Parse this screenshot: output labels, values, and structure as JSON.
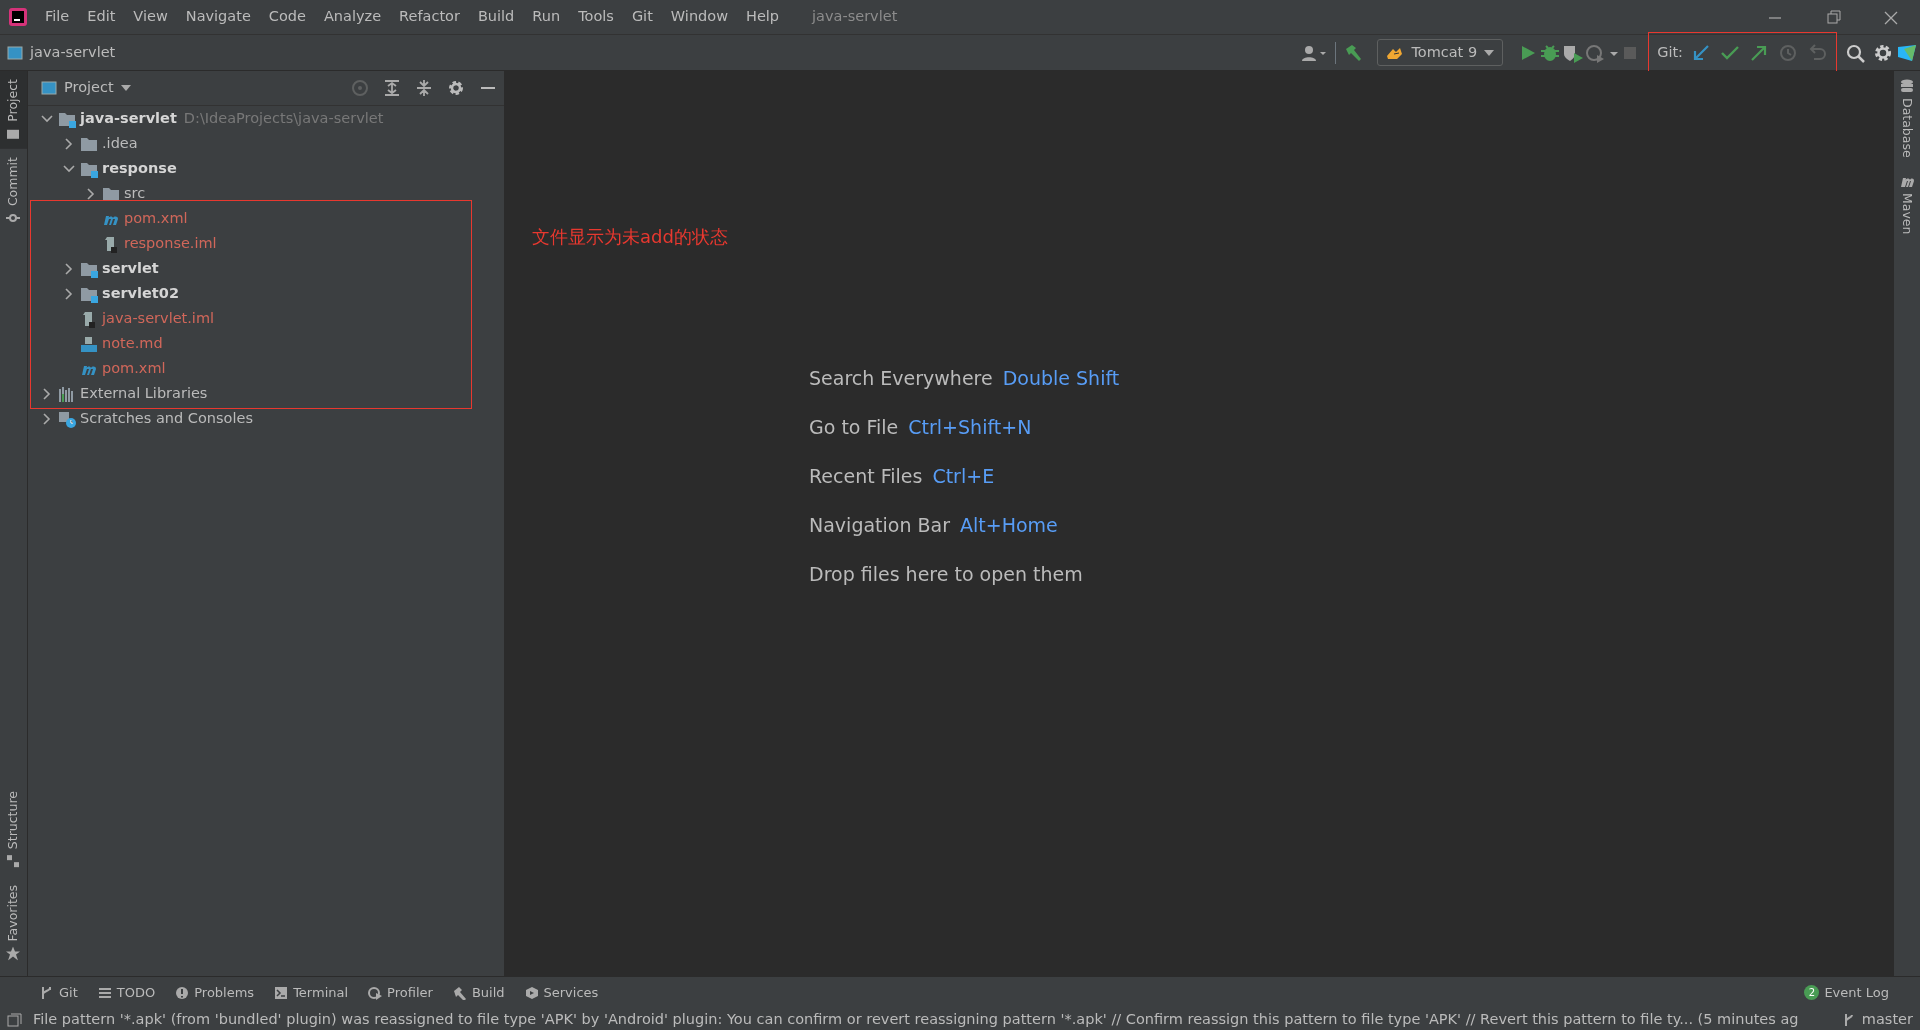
{
  "window": {
    "title": "java-servlet",
    "menu": [
      {
        "label": "File"
      },
      {
        "label": "Edit"
      },
      {
        "label": "View"
      },
      {
        "label": "Navigate"
      },
      {
        "label": "Code"
      },
      {
        "label": "Analyze"
      },
      {
        "label": "Refactor"
      },
      {
        "label": "Build"
      },
      {
        "label": "Run"
      },
      {
        "label": "Tools"
      },
      {
        "label": "Git"
      },
      {
        "label": "Window"
      },
      {
        "label": "Help"
      }
    ]
  },
  "navigation_bar": {
    "breadcrumb": "java-servlet"
  },
  "toolbar": {
    "run_configuration": "Tomcat 9",
    "git_label": "Git:"
  },
  "left_strip": {
    "top": [
      {
        "label": "Project",
        "selected": true
      },
      {
        "label": "Commit",
        "selected": false
      }
    ],
    "bottom": [
      {
        "label": "Structure",
        "selected": false
      },
      {
        "label": "Favorites",
        "selected": false
      }
    ]
  },
  "right_strip": [
    {
      "label": "Database"
    },
    {
      "label": "Maven"
    }
  ],
  "project_panel": {
    "title": "Project",
    "tree": [
      {
        "name": "java-servlet",
        "path": "D:\\IdeaProjects\\java-servlet",
        "kind": "module",
        "bold": true,
        "untracked": false,
        "expanded": true,
        "children": [
          {
            "name": ".idea",
            "kind": "folder",
            "bold": false,
            "untracked": false,
            "expanded": false
          },
          {
            "name": "response",
            "kind": "module",
            "bold": true,
            "untracked": false,
            "expanded": true,
            "children": [
              {
                "name": "src",
                "kind": "folder",
                "bold": false,
                "untracked": false,
                "expanded": false
              },
              {
                "name": "pom.xml",
                "kind": "maven",
                "bold": false,
                "untracked": true
              },
              {
                "name": "response.iml",
                "kind": "iml",
                "bold": false,
                "untracked": true
              }
            ]
          },
          {
            "name": "servlet",
            "kind": "module",
            "bold": true,
            "untracked": false,
            "expanded": false
          },
          {
            "name": "servlet02",
            "kind": "module",
            "bold": true,
            "untracked": false,
            "expanded": false
          },
          {
            "name": "java-servlet.iml",
            "kind": "iml",
            "bold": false,
            "untracked": true
          },
          {
            "name": "note.md",
            "kind": "md",
            "bold": false,
            "untracked": true
          },
          {
            "name": "pom.xml",
            "kind": "maven",
            "bold": false,
            "untracked": true
          }
        ]
      },
      {
        "name": "External Libraries",
        "kind": "libraries",
        "bold": false,
        "untracked": false,
        "expanded": false
      },
      {
        "name": "Scratches and Consoles",
        "kind": "scratches",
        "bold": false,
        "untracked": false,
        "expanded": false
      }
    ]
  },
  "annotation": "文件显示为未add的状态",
  "editor_hints": [
    {
      "label": "Search Everywhere",
      "shortcut": "Double Shift"
    },
    {
      "label": "Go to File",
      "shortcut": "Ctrl+Shift+N"
    },
    {
      "label": "Recent Files",
      "shortcut": "Ctrl+E"
    },
    {
      "label": "Navigation Bar",
      "shortcut": "Alt+Home"
    },
    {
      "label": "Drop files here to open them"
    }
  ],
  "tool_windows": [
    {
      "label": "Git",
      "kind": "git"
    },
    {
      "label": "TODO",
      "kind": "todo"
    },
    {
      "label": "Problems",
      "kind": "problems"
    },
    {
      "label": "Terminal",
      "kind": "terminal"
    },
    {
      "label": "Profiler",
      "kind": "profiler"
    },
    {
      "label": "Build",
      "kind": "build"
    },
    {
      "label": "Services",
      "kind": "services"
    }
  ],
  "event_log": {
    "count": "2",
    "label": "Event Log"
  },
  "status_bar": {
    "message": "File pattern '*.apk' (from 'bundled' plugin) was reassigned to file type 'APK' by 'Android' plugin: You can confirm or revert reassigning pattern '*.apk' // Confirm reassign this pattern to file type 'APK' // Revert this pattern to file ty... (5 minutes ag",
    "branch": "master"
  }
}
